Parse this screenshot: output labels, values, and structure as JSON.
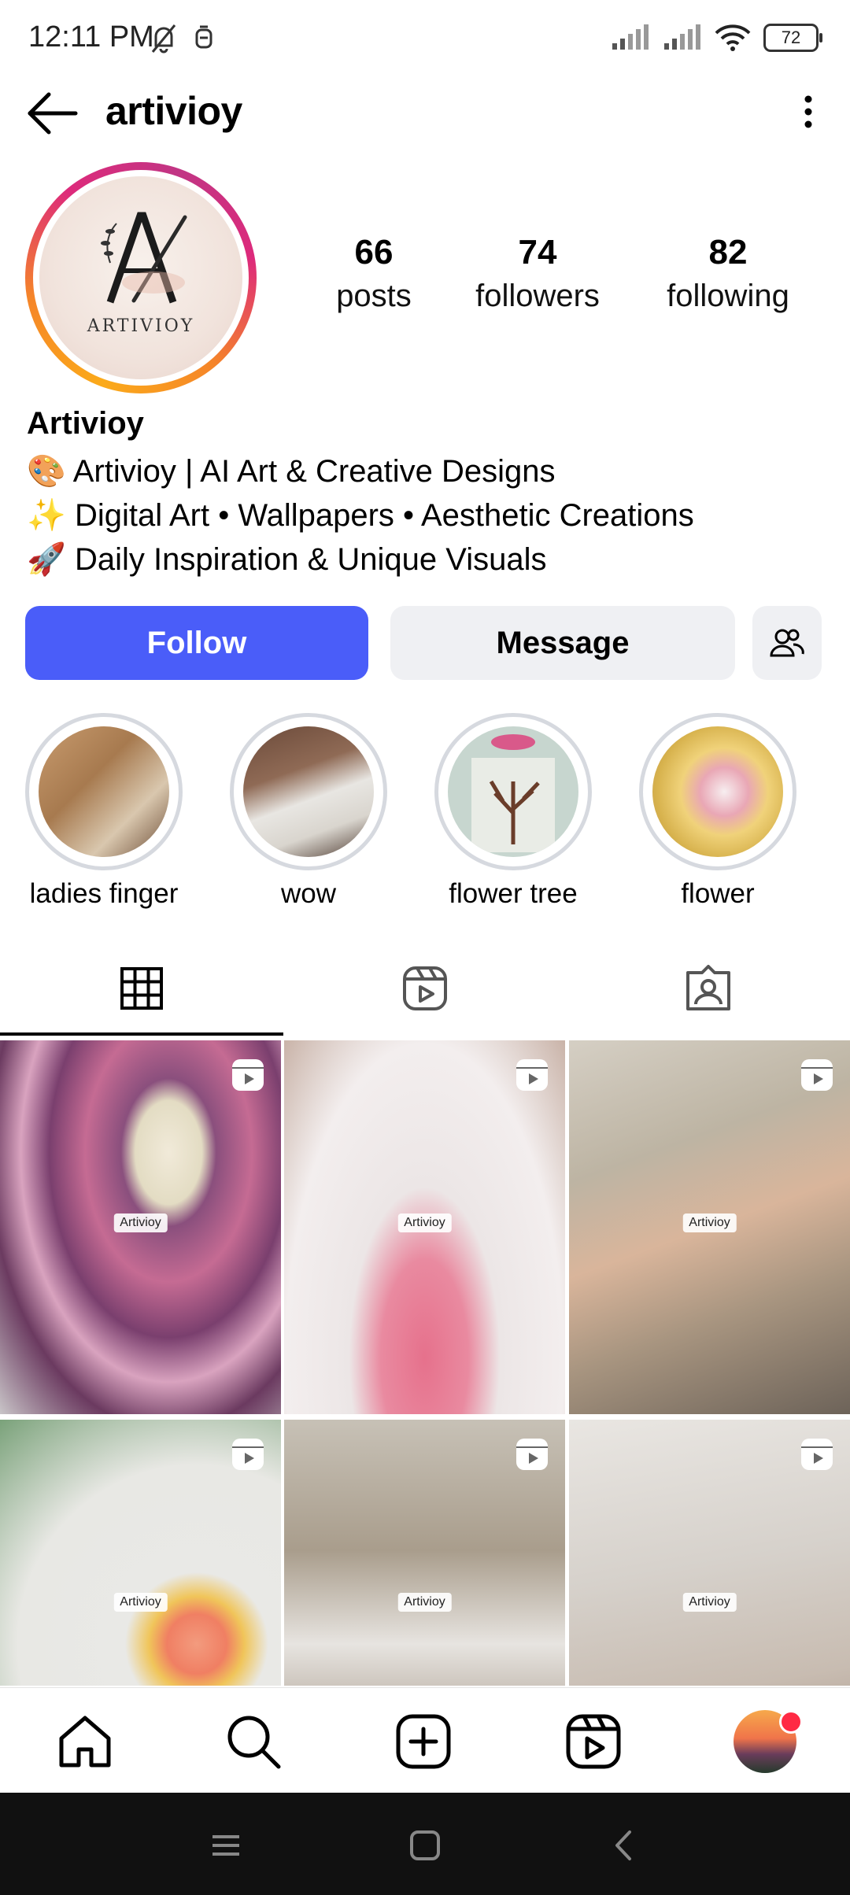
{
  "status_bar": {
    "time": "12:11 PM",
    "battery": "72"
  },
  "header": {
    "username": "artivioy"
  },
  "profile": {
    "avatar_text": "ARTIVIOY",
    "stats": [
      {
        "value": "66",
        "label": "posts"
      },
      {
        "value": "74",
        "label": "followers"
      },
      {
        "value": "82",
        "label": "following"
      }
    ],
    "name": "Artivioy",
    "bio": [
      {
        "emoji": "🎨",
        "text": "Artivioy | AI Art & Creative Designs"
      },
      {
        "emoji": "✨",
        "text": "Digital Art • Wallpapers • Aesthetic Creations"
      },
      {
        "emoji": "🚀",
        "text": "Daily Inspiration & Unique Visuals"
      }
    ]
  },
  "actions": {
    "follow": "Follow",
    "message": "Message",
    "suggest_icon": "person-add-icon"
  },
  "highlights": [
    {
      "label": "ladies finger"
    },
    {
      "label": "wow"
    },
    {
      "label": "flower tree"
    },
    {
      "label": "flower"
    }
  ],
  "tabs": [
    {
      "icon": "grid-icon",
      "active": true
    },
    {
      "icon": "reels-icon",
      "active": false
    },
    {
      "icon": "tagged-icon",
      "active": false
    }
  ],
  "posts": [
    {
      "watermark": "Artivioy",
      "type": "reel"
    },
    {
      "watermark": "Artivioy",
      "type": "reel"
    },
    {
      "watermark": "Artivioy",
      "type": "reel"
    },
    {
      "watermark": "Artivioy",
      "type": "reel"
    },
    {
      "watermark": "Artivioy",
      "type": "reel"
    },
    {
      "watermark": "Artivioy",
      "type": "reel"
    }
  ],
  "bottom_nav": [
    "home-icon",
    "search-icon",
    "create-icon",
    "reels-icon",
    "profile-avatar"
  ],
  "colors": {
    "follow_button": "#4a5df9",
    "secondary_button": "#eff0f3"
  }
}
